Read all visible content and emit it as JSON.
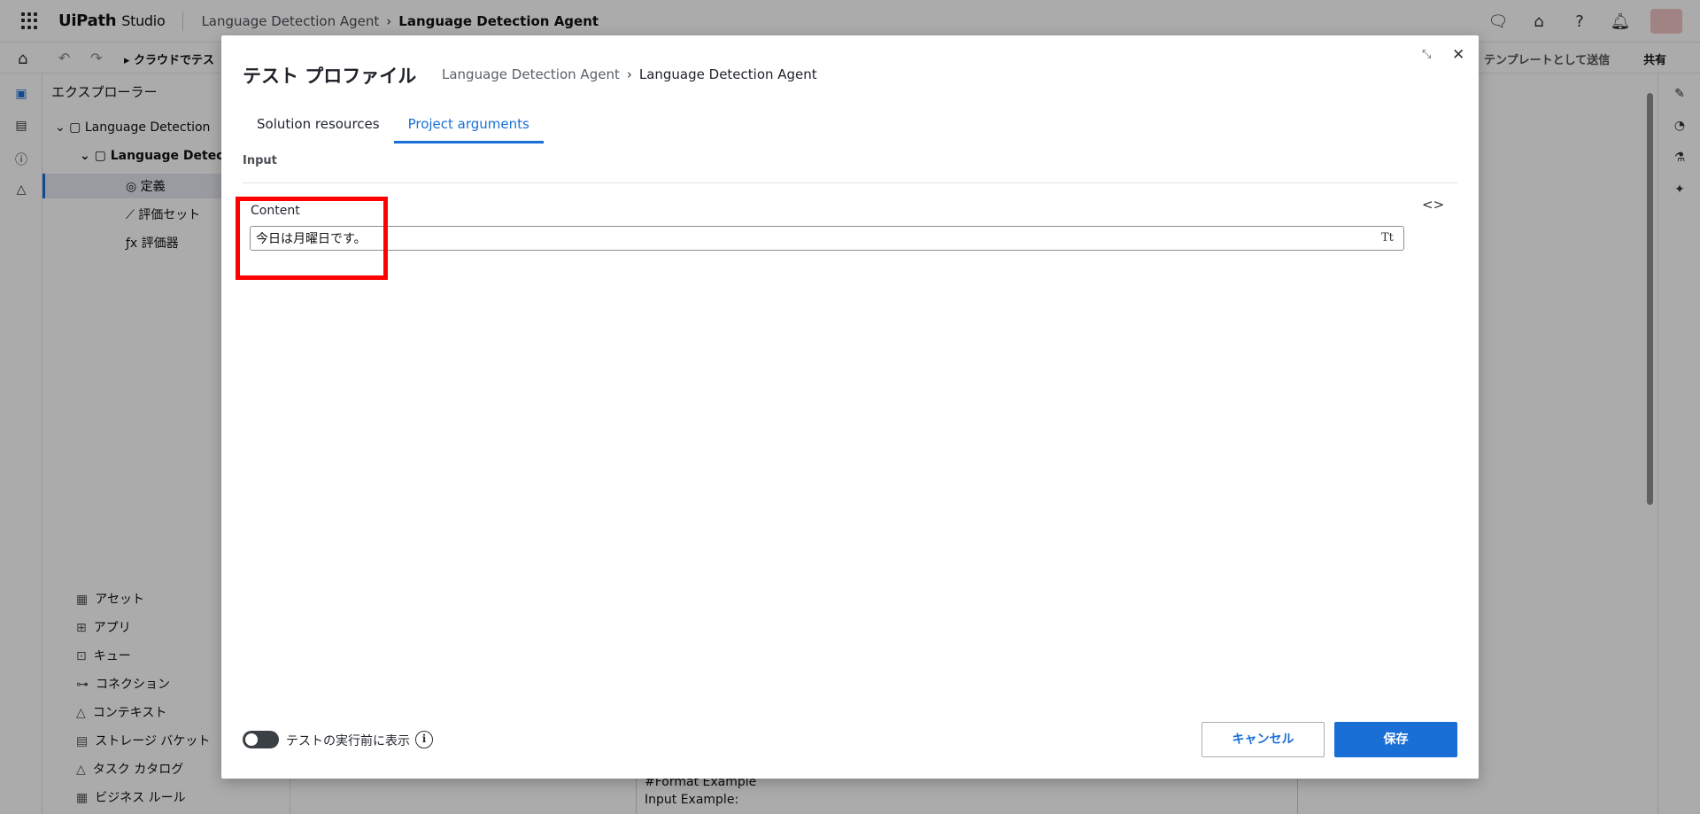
{
  "app": {
    "logo": "UiPath",
    "product": "Studio",
    "breadcrumb": [
      "Language Detection Agent",
      "Language Detection Agent"
    ]
  },
  "toolbar": {
    "run_label": "▸ クラウドでテス",
    "template_send_label": "テンプレートとして送信",
    "share_label": "共有"
  },
  "explorer": {
    "title": "エクスプローラー",
    "tree": [
      {
        "label": "Language Detection"
      },
      {
        "label": "Language Detec"
      },
      {
        "label": "定義"
      },
      {
        "label": "評価セット"
      },
      {
        "label": "評価器"
      }
    ],
    "bottom_items": [
      "アセット",
      "アプリ",
      "キュー",
      "コネクション",
      "コンテキスト",
      "ストレージ バケット",
      "タスク カタログ",
      "ビジネス ルール"
    ]
  },
  "editor": {
    "lines": [
      "#Format Example",
      "Input Example:"
    ]
  },
  "modal": {
    "title": "テスト プロファイル",
    "breadcrumb": [
      "Language Detection Agent",
      "Language Detection Agent"
    ],
    "tabs": [
      {
        "label": "Solution resources",
        "active": false
      },
      {
        "label": "Project arguments",
        "active": true
      }
    ],
    "section_label": "Input",
    "field": {
      "label": "Content",
      "value": "今日は月曜日です。",
      "format_icon": "Tt"
    },
    "show_before_run_label": "テストの実行前に表示",
    "show_before_run_enabled": false,
    "cancel_label": "キャンセル",
    "save_label": "保存"
  },
  "colors": {
    "accent": "#1a6fd6",
    "highlight": "#ff0000"
  }
}
